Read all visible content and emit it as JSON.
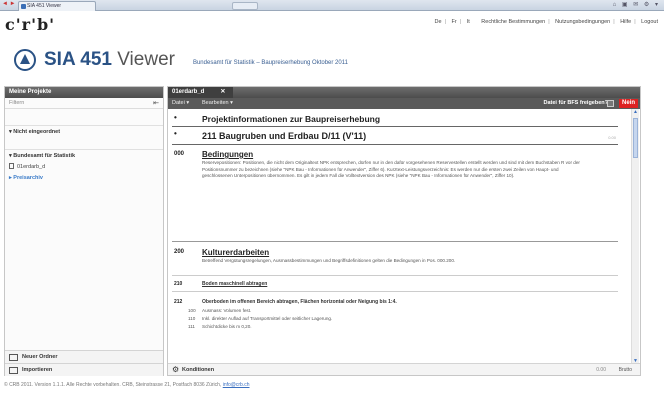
{
  "browser": {
    "tab_title": "SIA 451 Viewer"
  },
  "header": {
    "logo": "c'r'b'",
    "top_links": [
      "De",
      "Fr",
      "It",
      "Rechtliche Bestimmungen",
      "Nutzungsbedingungen",
      "Hilfe",
      "Logout"
    ],
    "app_name_bold": "SIA 451",
    "app_name_light": " Viewer",
    "subtitle": "Bundesamt für Statistik – Baupreiserhebung Oktober 2011"
  },
  "sidebar": {
    "title": "Meine Projekte",
    "filter_placeholder": "Filtern",
    "group_unassigned": "Nicht eingeordnet",
    "group_bfs": "Bundesamt für Statistik",
    "project_item": "01erdarb_d",
    "archive": "Preisarchiv",
    "btn_new_folder": "Neuer Ordner",
    "btn_import": "Importieren"
  },
  "main": {
    "tab_label": "01erdarb_d",
    "menu_file": "Datei",
    "menu_edit": "Bearbeiten",
    "release_label": "Datei für BFS freigeben?",
    "release_state": "Nein",
    "row1": "Projektinformationen zur Baupreiserhebung",
    "row2": "211 Baugruben und Erdbau D/11 (V'11)",
    "row2_small": "0.00",
    "s000_num": "000",
    "s000_head": "Bedingungen",
    "s000_body": "Reservepositionen: Positionen, die nicht dem Originaltext NPK entsprechen, dürfen nur in den dafür vorgesehenen Reservestellen erstellt werden und sind mit dem Buchstaben R vor der Positionsnummer zu bezeichnen (siehe \"NPK Bau - Informationen für Anwender\", Ziffer 6). Kurztext-Leistungsverzeichnis: Es werden nur die ersten zwei Zeilen von Haupt- und geschlossenen Unterpositionen übernommen. Es gilt in jedem Fall die Volltextversion des NPK (siehe \"NPK Bau - Informationen für Anwender\", Ziffer 10).",
    "s200_num": "200",
    "s200_head": "Kulturerdarbeiten",
    "s200_body": "Betreffend Vergütungsregelungen, Ausmassbestimmungen und Begriffsdefinitionen gelten die Bedingungen in Pos. 000.200.",
    "s210_num": "210",
    "s210_head": "Boden maschinell abtragen",
    "s212_num": "212",
    "s212_head": "Oberboden im offenen Bereich abtragen, Flächen horizontal oder Neigung bis 1:4.",
    "s212_lines": [
      {
        "code": "100",
        "text": "Ausmass: Volumen fest."
      },
      {
        "code": "110",
        "text": "Inkl. direkter Auflad auf Transportmittel oder seitlicher Lagerung."
      },
      {
        "code": "111",
        "text": "Schichtdicke bis m 0,20."
      }
    ],
    "footer_label": "Konditionen",
    "footer_value": "0.00",
    "footer_unit": "Brutto"
  },
  "status": {
    "text": "© CRB 2011. Version 1.1.1. Alle Rechte vorbehalten. CRB, Steinstrasse 21, Postfach 8036 Zürich,",
    "link": "info@crb.ch"
  }
}
